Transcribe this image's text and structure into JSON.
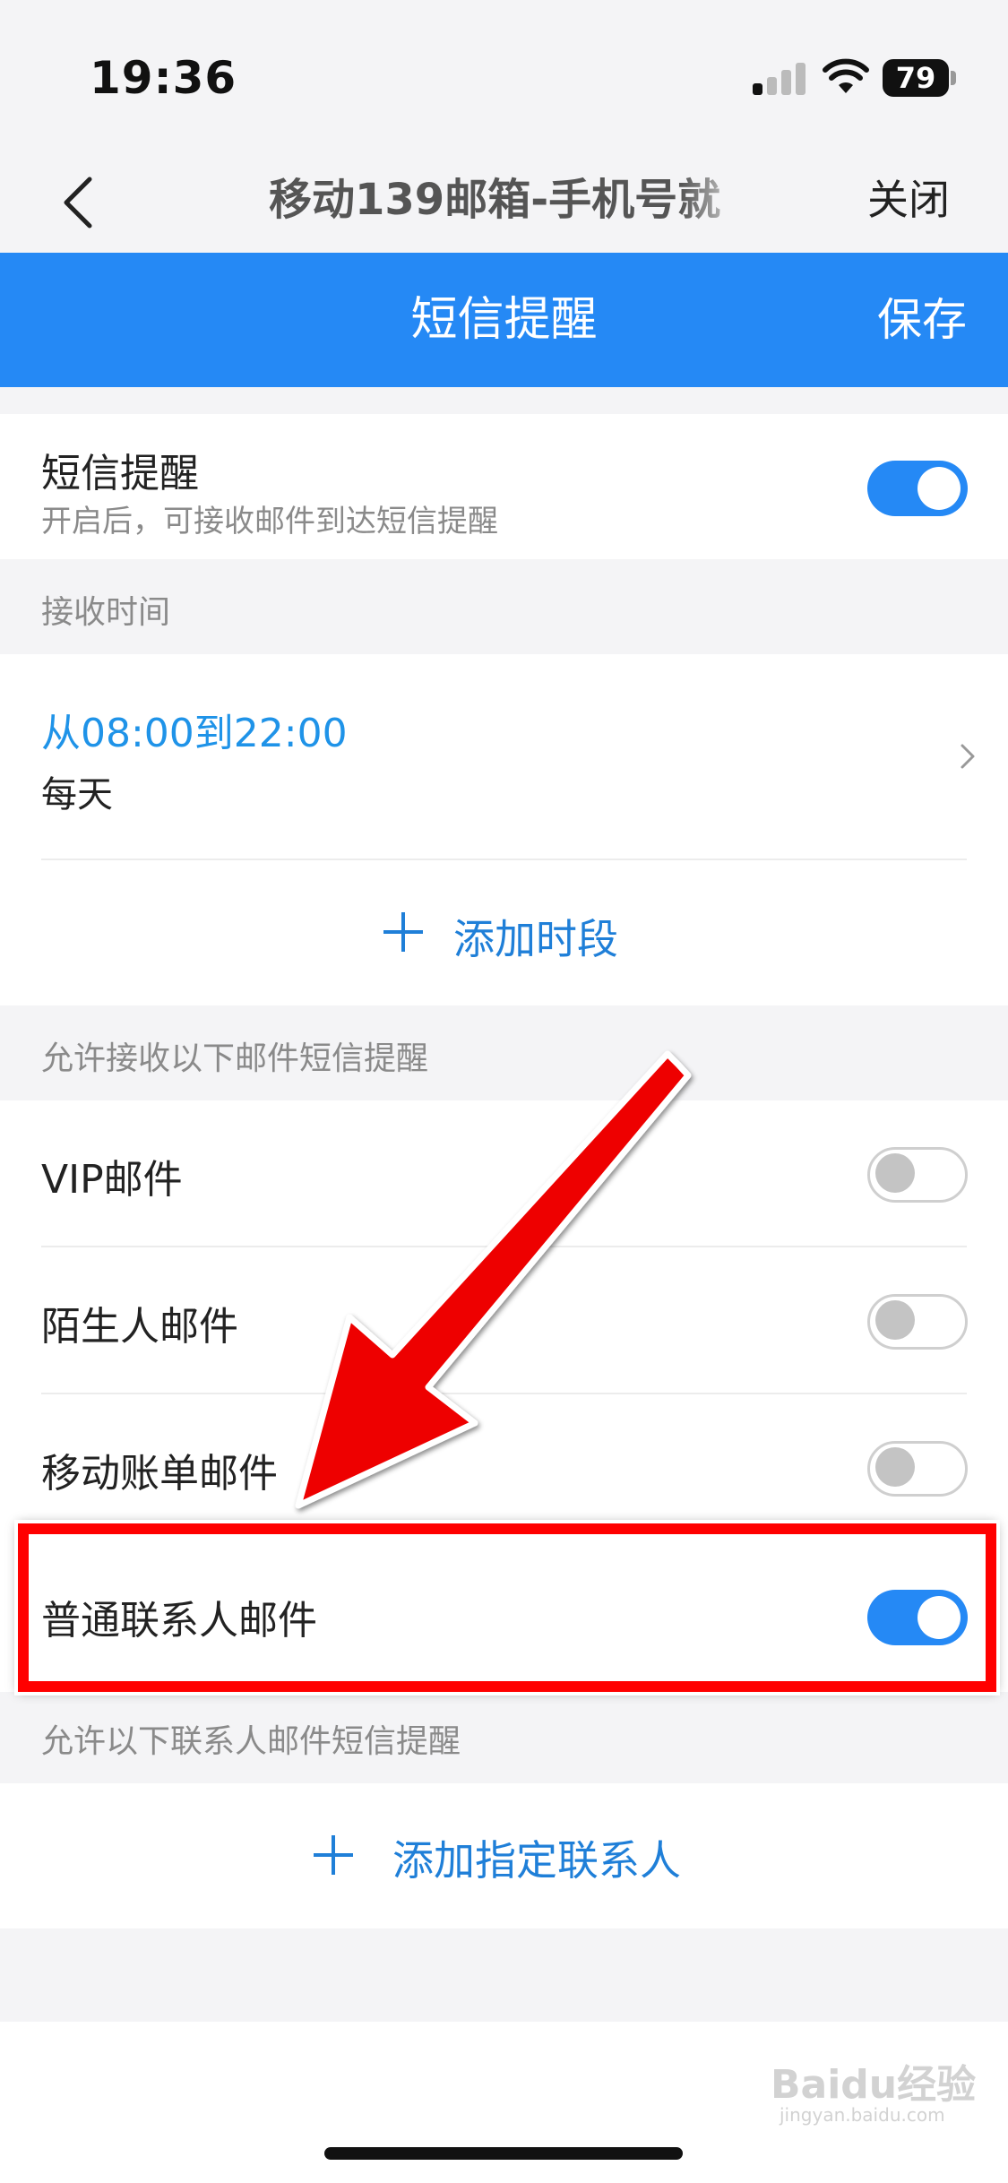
{
  "status_bar": {
    "time": "19:36",
    "battery": "79"
  },
  "nav": {
    "title": "移动139邮箱-手机号就",
    "close_label": "关闭"
  },
  "header": {
    "title": "短信提醒",
    "save_label": "保存"
  },
  "sms_toggle": {
    "title": "短信提醒",
    "subtitle": "开启后，可接收邮件到达短信提醒",
    "on": true
  },
  "receive_time": {
    "section_label": "接收时间",
    "range": "从08:00到22:00",
    "repeat": "每天",
    "add_label": "添加时段"
  },
  "mail_types": {
    "section_label": "允许接收以下邮件短信提醒",
    "items": [
      {
        "label": "VIP邮件",
        "on": false
      },
      {
        "label": "陌生人邮件",
        "on": false
      },
      {
        "label": "移动账单邮件",
        "on": false
      },
      {
        "label": "普通联系人邮件",
        "on": true
      }
    ]
  },
  "contacts": {
    "section_label": "允许以下联系人邮件短信提醒",
    "add_label": "添加指定联系人"
  },
  "colors": {
    "accent": "#2589f5",
    "annotation": "#ff0000"
  },
  "watermark": {
    "text": "Baidu经验",
    "sub": "jingyan.baidu.com"
  }
}
